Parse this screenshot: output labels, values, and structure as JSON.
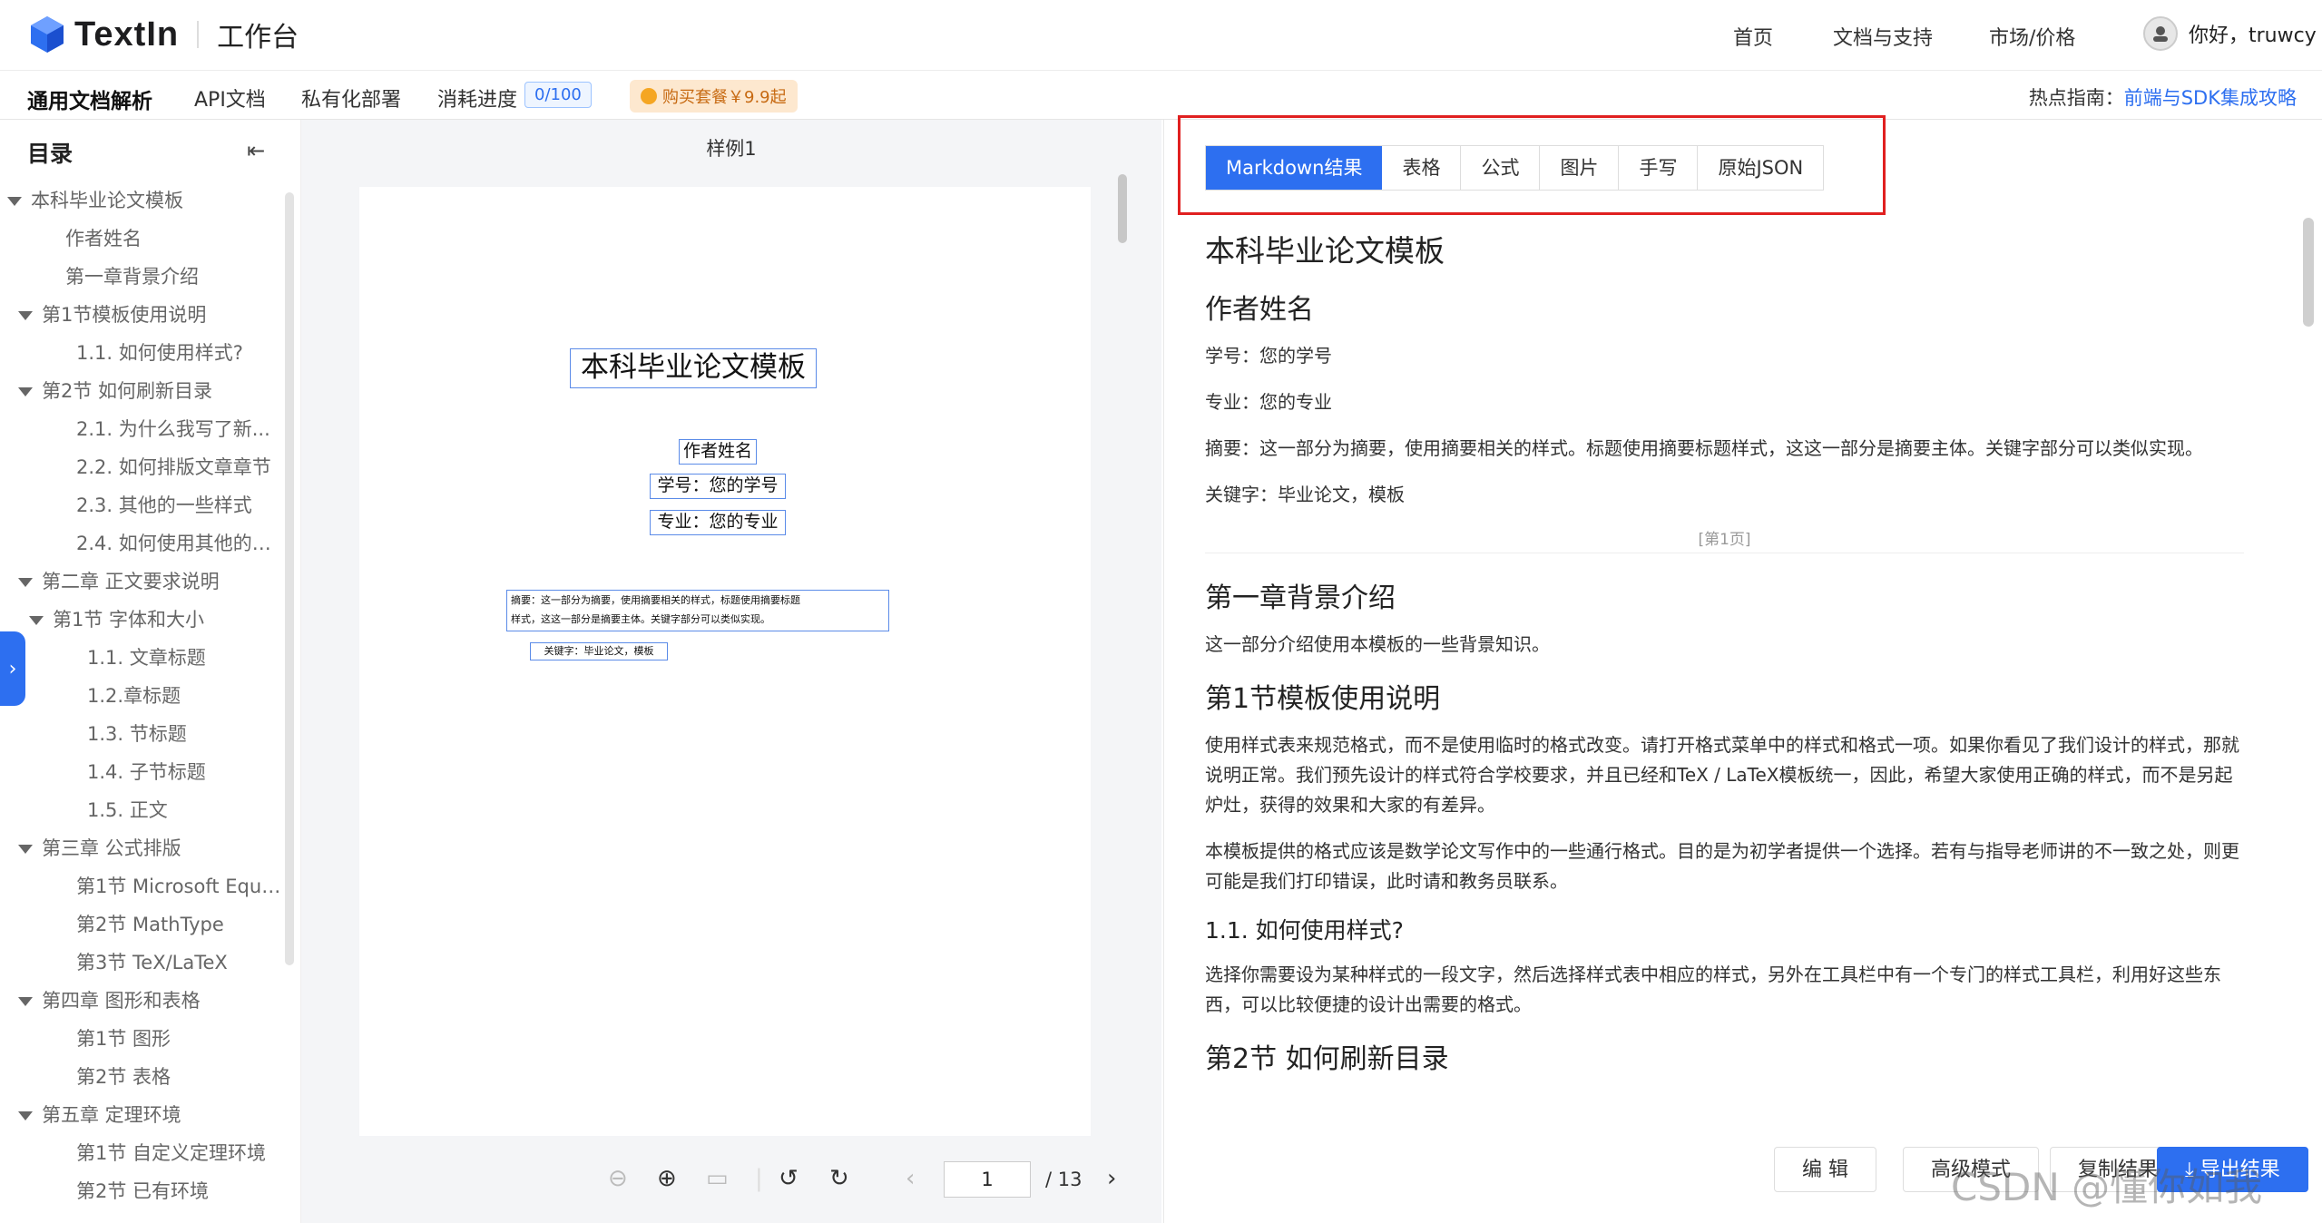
{
  "header": {
    "logo_text": "TextIn",
    "workspace": "工作台",
    "nav": [
      "首页",
      "文档与支持",
      "市场/价格"
    ],
    "user_greeting": "你好，truwcy"
  },
  "subnav": {
    "items": [
      "通用文档解析",
      "API文档",
      "私有化部署",
      "消耗进度"
    ],
    "usage": "0/100",
    "buy": "购买套餐￥9.9起",
    "hot_label": "热点指南：",
    "hot_link": "前端与SDK集成攻略"
  },
  "toc": {
    "title": "目录",
    "items": [
      {
        "label": "本科毕业论文模板",
        "arrow": true
      },
      {
        "label": "作者姓名",
        "arrow": false
      },
      {
        "label": "第一章背景介绍",
        "arrow": false
      },
      {
        "label": "第1节模板使用说明",
        "arrow": true
      },
      {
        "label": "1.1. 如何使用样式?",
        "arrow": false
      },
      {
        "label": "第2节 如何刷新目录",
        "arrow": true
      },
      {
        "label": "2.1. 为什么我写了新...",
        "arrow": false
      },
      {
        "label": "2.2. 如何排版文章章节",
        "arrow": false
      },
      {
        "label": "2.3. 其他的一些样式",
        "arrow": false
      },
      {
        "label": "2.4. 如何使用其他的高...",
        "arrow": false
      },
      {
        "label": "第二章 正文要求说明",
        "arrow": true
      },
      {
        "label": "第1节 字体和大小",
        "arrow": true
      },
      {
        "label": "1.1. 文章标题",
        "arrow": false
      },
      {
        "label": "1.2.章标题",
        "arrow": false
      },
      {
        "label": "1.3. 节标题",
        "arrow": false
      },
      {
        "label": "1.4. 子节标题",
        "arrow": false
      },
      {
        "label": "1.5. 正文",
        "arrow": false
      },
      {
        "label": "第三章 公式排版",
        "arrow": true
      },
      {
        "label": "第1节 Microsoft Equat...",
        "arrow": false
      },
      {
        "label": "第2节 MathType",
        "arrow": false
      },
      {
        "label": "第3节 TeX/LaTeX",
        "arrow": false
      },
      {
        "label": "第四章 图形和表格",
        "arrow": true
      },
      {
        "label": "第1节 图形",
        "arrow": false
      },
      {
        "label": "第2节 表格",
        "arrow": false
      },
      {
        "label": "第五章 定理环境",
        "arrow": true
      },
      {
        "label": "第1节 自定义定理环境",
        "arrow": false
      },
      {
        "label": "第2节 已有环境",
        "arrow": false
      }
    ]
  },
  "preview": {
    "sample_label": "样例1",
    "doc_title": "本科毕业论文模板",
    "author": "作者姓名",
    "student_id": "学号：您的学号",
    "major": "专业：您的专业",
    "abstract_line1": "摘要：这一部分为摘要，使用摘要相关的样式，标题使用摘要标题",
    "abstract_line2": "样式，这这一部分是摘要主体。关键字部分可以类似实现。",
    "keywords": "关键字：毕业论文，模板",
    "page_current": "1",
    "page_total": "/ 13"
  },
  "result": {
    "tabs": [
      "Markdown结果",
      "表格",
      "公式",
      "图片",
      "手写",
      "原始JSON"
    ],
    "h1_title": "本科毕业论文模板",
    "h2_author": "作者姓名",
    "p_id": "学号：您的学号",
    "p_major": "专业：您的专业",
    "p_abstract": "摘要：这一部分为摘要，使用摘要相关的样式。标题使用摘要标题样式，这这一部分是摘要主体。关键字部分可以类似实现。",
    "p_keywords": "关键字：毕业论文，模板",
    "page_break": "[第1页]",
    "h2_ch1": "第一章背景介绍",
    "p_ch1": "这一部分介绍使用本模板的一些背景知识。",
    "h2_sec1": "第1节模板使用说明",
    "p_sec1_a": "使用样式表来规范格式，而不是使用临时的格式改变。请打开格式菜单中的样式和格式一项。如果你看见了我们设计的样式，那就说明正常。我们预先设计的样式符合学校要求，并且已经和TeX / LaTeX模板统一，因此，希望大家使用正确的样式，而不是另起炉灶，获得的效果和大家的有差异。",
    "p_sec1_b": "本模板提供的格式应该是数学论文写作中的一些通行格式。目的是为初学者提供一个选择。若有与指导老师讲的不一致之处，则更可能是我们打印错误，此时请和教务员联系。",
    "h3_11": "1.1. 如何使用样式?",
    "p_11": "选择你需要设为某种样式的一段文字，然后选择样式表中相应的样式，另外在工具栏中有一个专门的样式工具栏，利用好这些东西，可以比较便捷的设计出需要的格式。",
    "h2_sec2": "第2节 如何刷新目录",
    "buttons": [
      "编 辑",
      "高级模式",
      "复制结果",
      "导出结果"
    ]
  },
  "watermark": "CSDN @懂你如我"
}
